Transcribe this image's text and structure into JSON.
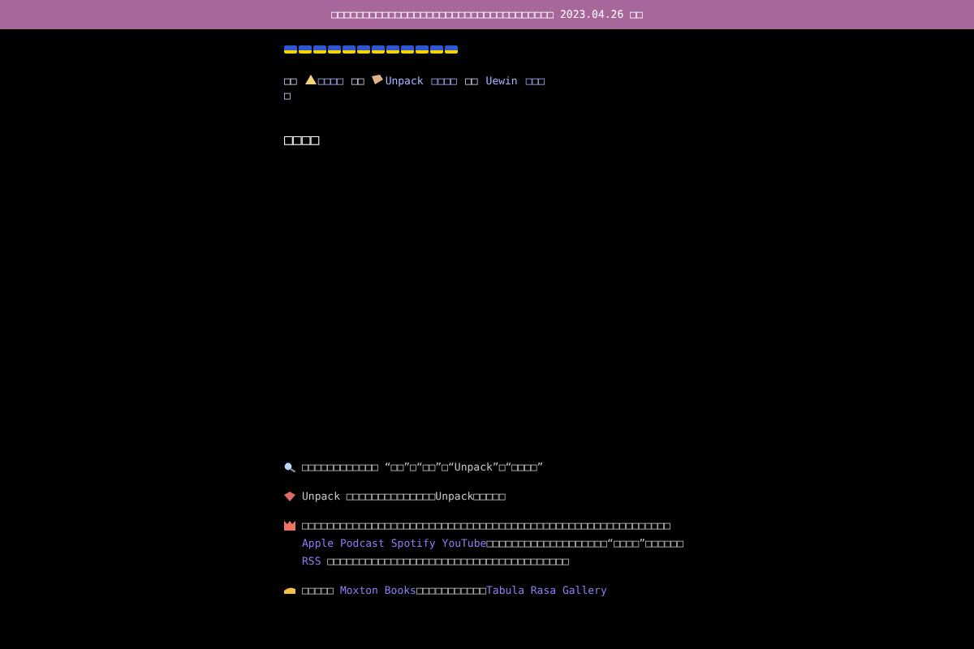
{
  "banner": {
    "text": "□□□□□□□□□□□□□□□□□□□□□□□□□□□□□□□□□□□ 2023.04.26 □□"
  },
  "nav": [
    {
      "kind": "text",
      "text": "□□"
    },
    {
      "kind": "link",
      "text": "□□□□"
    },
    {
      "kind": "text",
      "text": "□□"
    },
    {
      "kind": "link",
      "text": "Unpack"
    },
    {
      "kind": "link",
      "text": "□□□□"
    },
    {
      "kind": "text",
      "text": "□□"
    },
    {
      "kind": "link",
      "text": "Uewin"
    },
    {
      "kind": "link",
      "text": "□□□"
    },
    {
      "kind": "break"
    },
    {
      "kind": "text",
      "text": "□"
    }
  ],
  "heading": "□□□□",
  "items": [
    {
      "parts": [
        {
          "kind": "text",
          "text": "□□□□□□□□□□□□ “□□”□“□□”□“Unpack”□“□□□□”"
        }
      ]
    },
    {
      "parts": [
        {
          "kind": "text",
          "text": "Unpack □□□□□□□□□□□□□□Unpack□□□□□"
        }
      ]
    },
    {
      "parts": [
        {
          "kind": "text",
          "text": "□□□□□□□□□□□□□□□□□□□□□□□□□□□□□□□□□□□□□□□□□□□□□□□□□□□□□□□□□□"
        },
        {
          "kind": "link",
          "text": "Apple Podcast"
        },
        {
          "kind": "link",
          "text": "Spotify"
        },
        {
          "kind": "link",
          "text": "YouTube"
        },
        {
          "kind": "text",
          "text": "□□□□□□□□□□□□□□□□□□□“□□□□”□□□□□□ "
        },
        {
          "kind": "link",
          "text": "RSS"
        },
        {
          "kind": "text",
          "text": " □□□□□□□□□□□□□□□□□□□□□□□□□□□□□□□□□□□□□□"
        }
      ]
    },
    {
      "parts": [
        {
          "kind": "text",
          "text": "□□□□□ "
        },
        {
          "kind": "link",
          "text": "Moxton Books"
        },
        {
          "kind": "text",
          "text": "□□□□□□□□□□□"
        },
        {
          "kind": "link",
          "text": "Tabula Rasa Gallery"
        }
      ]
    }
  ]
}
